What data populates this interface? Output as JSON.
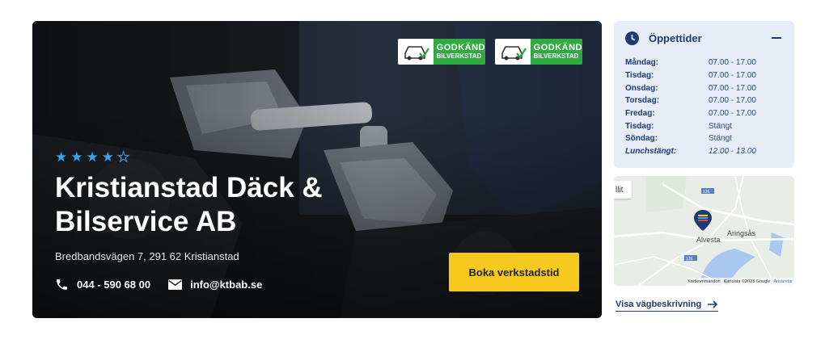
{
  "hero": {
    "badges": [
      {
        "line1": "GODKÄND",
        "line2": "BILVERKSTAD"
      },
      {
        "line1": "GODKÄND",
        "line2": "BILVERKSTAD"
      }
    ],
    "rating": 4,
    "rating_max": 5,
    "title": "Kristianstad Däck & Bilservice AB",
    "address": "Bredbandsvägen 7, 291 62 Kristianstad",
    "phone": "044 - 590 68 00",
    "email": "info@ktbab.se",
    "cta_label": "Boka verkstadstid",
    "colors": {
      "star": "#3aa3ef",
      "cta": "#f7c81e",
      "badge_green": "#2fa940"
    }
  },
  "hours": {
    "title": "Öppettider",
    "rows": [
      {
        "day": "Måndag:",
        "time": "07.00 - 17.00"
      },
      {
        "day": "Tisdag:",
        "time": "07.00 - 17.00"
      },
      {
        "day": "Onsdag:",
        "time": "07.00 - 17.00"
      },
      {
        "day": "Torsdag:",
        "time": "07.00 - 17.00"
      },
      {
        "day": "Fredag:",
        "time": "07.00 - 17.00"
      },
      {
        "day": "Tisdag:",
        "time": "Stängt"
      },
      {
        "day": "Söndag:",
        "time": "Stängt"
      },
      {
        "day": "Lunchstängt:",
        "time": "12.00 - 13.00"
      }
    ],
    "colors": {
      "panel": "#e6edf6",
      "text": "#1f3a73"
    }
  },
  "map": {
    "map_type_label": "llit",
    "towns": [
      "Alvesta",
      "Aringsås"
    ],
    "road_labels": [
      "126",
      "126"
    ],
    "attribution": [
      "Kortkommandon",
      "Kartdata ©2023 Google",
      "Användar"
    ]
  },
  "directions_label": "Visa vägbeskrivning"
}
